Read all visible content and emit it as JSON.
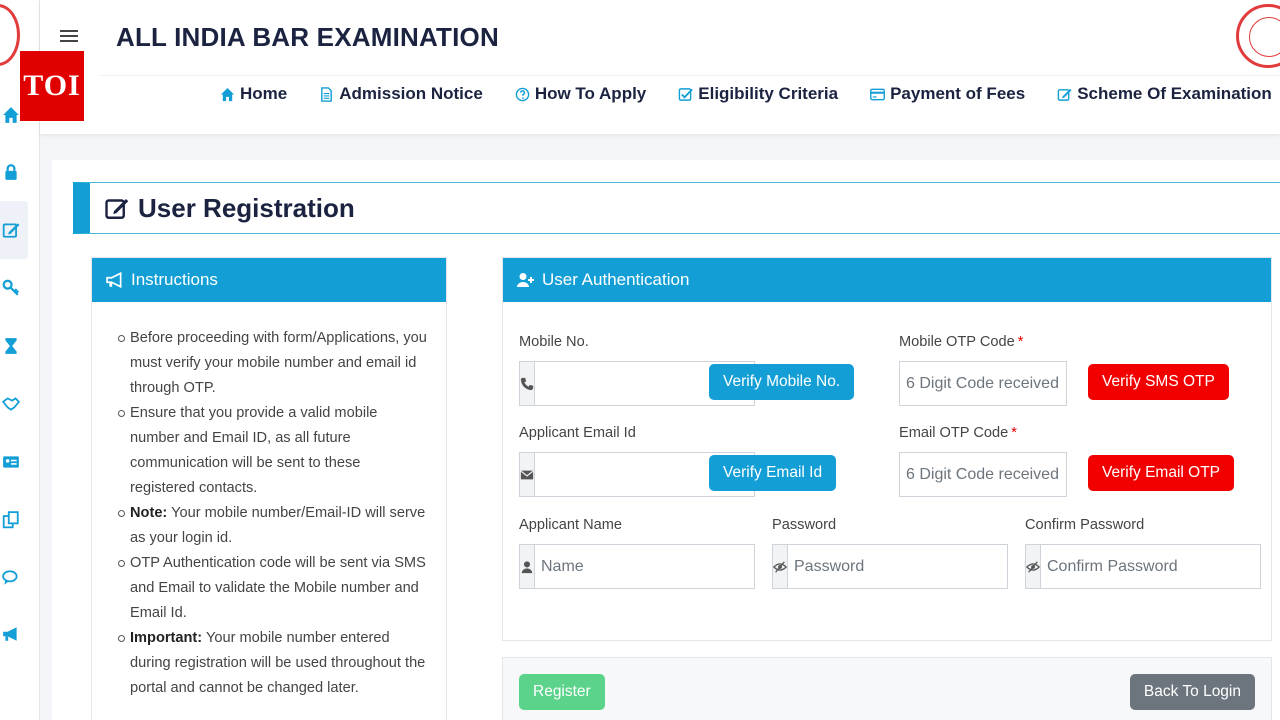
{
  "header": {
    "site_title": "ALL INDIA BAR EXAMINATION",
    "overlay_badge": "TOI"
  },
  "nav": [
    {
      "label": "Home",
      "icon": "home-icon"
    },
    {
      "label": "Admission Notice",
      "icon": "document-icon"
    },
    {
      "label": "How To Apply",
      "icon": "question-circle-icon"
    },
    {
      "label": "Eligibility Criteria",
      "icon": "check-square-icon"
    },
    {
      "label": "Payment of Fees",
      "icon": "credit-card-icon"
    },
    {
      "label": "Scheme Of Examination",
      "icon": "edit-icon"
    }
  ],
  "sidebar_icons": [
    "home-icon",
    "lock-icon",
    "edit-icon",
    "key-icon",
    "hourglass-icon",
    "handshake-icon",
    "id-card-icon",
    "copy-icon",
    "comments-icon",
    "bullhorn-icon"
  ],
  "page": {
    "title": "User Registration"
  },
  "instructions": {
    "title": "Instructions",
    "items": [
      {
        "bold": "",
        "text": "Before proceeding with form/Applications, you must verify your mobile number and email id through OTP."
      },
      {
        "bold": "",
        "text": "Ensure that you provide a valid mobile number and Email ID, as all future communication will be sent to these registered contacts."
      },
      {
        "bold": "Note:",
        "text": " Your mobile number/Email-ID will serve as your login id."
      },
      {
        "bold": "",
        "text": "OTP Authentication code will be sent via SMS and Email to validate the Mobile number and Email Id."
      },
      {
        "bold": "Important:",
        "text": " Your mobile number entered during registration will be used throughout the portal and cannot be changed later."
      }
    ]
  },
  "auth": {
    "title": "User Authentication",
    "mobile_label": "Mobile No.",
    "mobile_value": "",
    "verify_mobile_label": "Verify Mobile No.",
    "mobile_otp_label": "Mobile OTP Code",
    "mobile_otp_placeholder": "6 Digit Code received",
    "verify_sms_label": "Verify SMS OTP",
    "email_label": "Applicant Email Id",
    "email_value": "",
    "verify_email_label": "Verify Email Id",
    "email_otp_label": "Email OTP Code",
    "email_otp_placeholder": "6 Digit Code received",
    "verify_email_otp_label": "Verify Email OTP",
    "name_label": "Applicant Name",
    "name_placeholder": "Name",
    "password_label": "Password",
    "password_placeholder": "Password",
    "confirm_label": "Confirm Password",
    "confirm_placeholder": "Confirm Password",
    "required_mark": "*"
  },
  "footer": {
    "register_label": "Register",
    "back_label": "Back To Login"
  },
  "colors": {
    "primary": "#139fd6",
    "danger": "#f20000",
    "success": "#5bd38b",
    "secondary": "#6c757d",
    "title_text": "#1b2340"
  }
}
